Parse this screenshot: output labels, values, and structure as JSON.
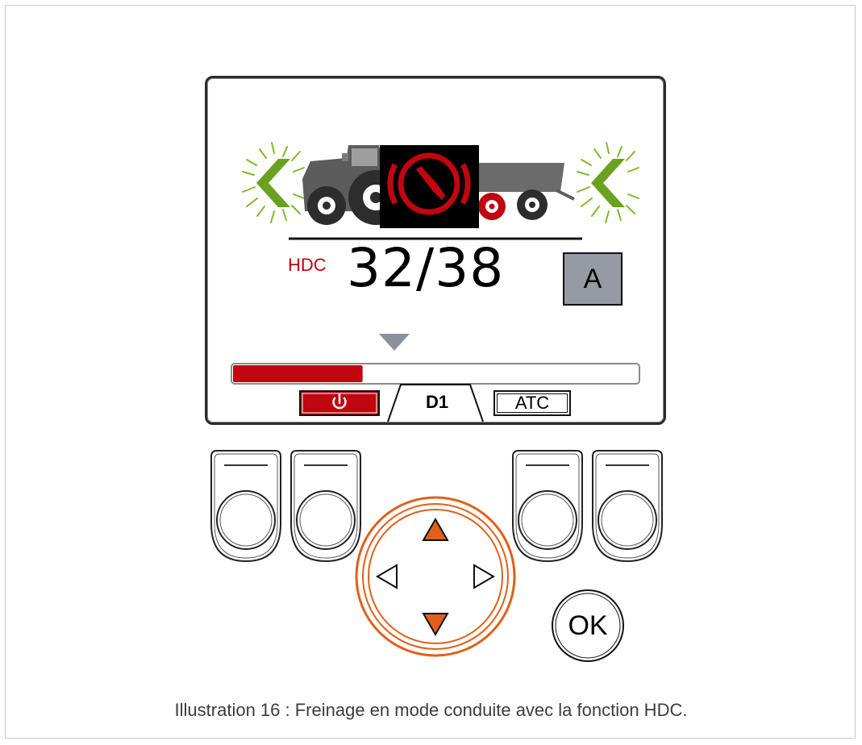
{
  "display": {
    "hdc_label": "HDC",
    "speed_text": "32/38",
    "mode_letter": "A",
    "progress_fraction": 0.32,
    "tabs": {
      "power_icon": "power-icon",
      "d1_label": "D1",
      "atc_label": "ATC"
    },
    "icons": [
      "chevron-left-icon",
      "tractor-icon",
      "brake-warning-icon",
      "trailer-icon",
      "chevron-left-icon"
    ]
  },
  "controls": {
    "ok_label": "OK",
    "dpad": [
      "arrow-up-icon",
      "arrow-left-icon",
      "arrow-right-icon",
      "arrow-down-icon"
    ]
  },
  "caption": "Illustration 16 : Freinage en mode conduite avec la fonction HDC.",
  "colors": {
    "hdc_red": "#c0000c",
    "chevron_green": "#6aa121",
    "dpad_orange": "#e0601a",
    "mode_gray": "#969aa5"
  }
}
